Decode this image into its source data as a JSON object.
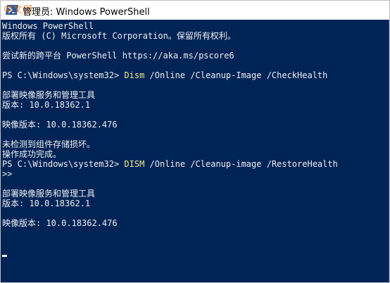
{
  "window": {
    "title": "管理员: Windows PowerShell",
    "watermark": "中文网"
  },
  "console": {
    "lines": [
      {
        "text": "Windows PowerShell"
      },
      {
        "text": "版权所有 (C) Microsoft Corporation。保留所有权利。"
      },
      {
        "text": ""
      },
      {
        "text": "尝试新的跨平台 PowerShell https://aka.ms/pscore6"
      },
      {
        "text": ""
      },
      {
        "prompt": "PS C:\\Windows\\system32> ",
        "command": "Dism",
        "args": " /Online /Cleanup-Image /CheckHealth"
      },
      {
        "text": ""
      },
      {
        "text": "部署映像服务和管理工具"
      },
      {
        "text": "版本: 10.0.18362.1"
      },
      {
        "text": ""
      },
      {
        "text": "映像版本: 10.0.18362.476"
      },
      {
        "text": ""
      },
      {
        "text": "未检测到组件存储损坏。"
      },
      {
        "text": "操作成功完成。"
      },
      {
        "prompt": "PS C:\\Windows\\system32> ",
        "command": "DISM",
        "args": " /Online /Cleanup-image /RestoreHealth"
      },
      {
        "text": ">>"
      },
      {
        "text": ""
      },
      {
        "text": "部署映像服务和管理工具"
      },
      {
        "text": "版本: 10.0.18362.1"
      },
      {
        "text": ""
      },
      {
        "text": "映像版本: 10.0.18362.476"
      },
      {
        "text": ""
      },
      {
        "text": ""
      },
      {
        "cursor": true
      }
    ]
  },
  "colors": {
    "background": "#012456",
    "foreground": "#eeedf0",
    "command": "#f0e68c"
  }
}
